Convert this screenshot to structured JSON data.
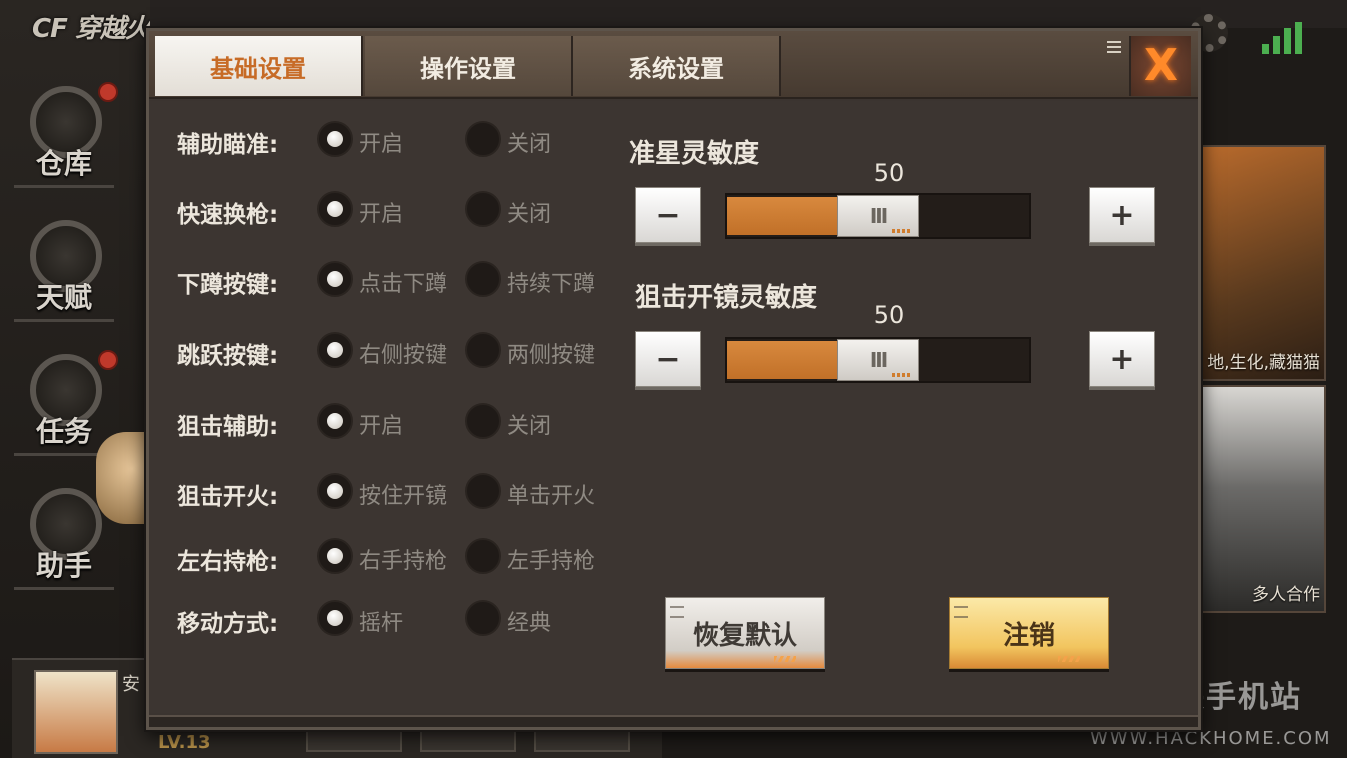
{
  "background": {
    "logo_text": "CF 穿越火线",
    "side_menu": [
      {
        "label": "仓库",
        "has_badge": true
      },
      {
        "label": "天赋",
        "has_badge": false
      },
      {
        "label": "任务",
        "has_badge": true
      },
      {
        "label": "助手",
        "has_badge": false
      }
    ],
    "profile": {
      "name": "安",
      "level": "LV.13"
    },
    "cards": [
      {
        "caption": "地,生化,藏猫猫"
      },
      {
        "caption": "多人合作"
      }
    ],
    "watermark": {
      "cn": "网侠手机站",
      "en": "WWW.HACKHOME.COM"
    }
  },
  "tabs": [
    {
      "label": "基础设置",
      "active": true
    },
    {
      "label": "操作设置",
      "active": false
    },
    {
      "label": "系统设置",
      "active": false
    }
  ],
  "options": [
    {
      "label": "辅助瞄准:",
      "a": "开启",
      "b": "关闭",
      "selected": "a"
    },
    {
      "label": "快速换枪:",
      "a": "开启",
      "b": "关闭",
      "selected": "a"
    },
    {
      "label": "下蹲按键:",
      "a": "点击下蹲",
      "b": "持续下蹲",
      "selected": "a"
    },
    {
      "label": "跳跃按键:",
      "a": "右侧按键",
      "b": "两侧按键",
      "selected": "a"
    },
    {
      "label": "狙击辅助:",
      "a": "开启",
      "b": "关闭",
      "selected": "a"
    },
    {
      "label": "狙击开火:",
      "a": "按住开镜",
      "b": "单击开火",
      "selected": "a"
    },
    {
      "label": "左右持枪:",
      "a": "右手持枪",
      "b": "左手持枪",
      "selected": "a"
    },
    {
      "label": "移动方式:",
      "a": "摇杆",
      "b": "经典",
      "selected": "a"
    }
  ],
  "sliders": [
    {
      "title": "准星灵敏度",
      "value": "50",
      "fraction": 0.5
    },
    {
      "title": "狙击开镜灵敏度",
      "value": "50",
      "fraction": 0.5
    }
  ],
  "slider_buttons": {
    "minus": "−",
    "plus": "+",
    "thumb_grip": "III"
  },
  "buttons": {
    "restore": "恢复默认",
    "logout": "注销",
    "close": "X"
  },
  "colors": {
    "accent": "#c76b26",
    "fill": "#d8893e",
    "close": "#ff8a2a"
  }
}
